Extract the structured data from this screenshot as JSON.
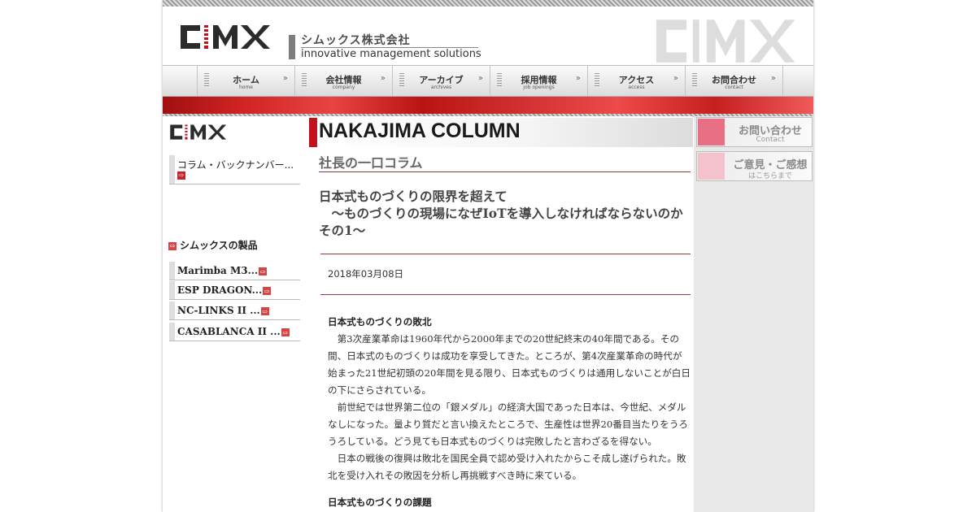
{
  "header": {
    "logo_text": "CIMX",
    "company_name": "シムックス株式会社",
    "tagline": "innovative management solutions"
  },
  "nav": {
    "items": [
      {
        "jp": "ホーム",
        "en": "home"
      },
      {
        "jp": "会社情報",
        "en": "company"
      },
      {
        "jp": "アーカイブ",
        "en": "archives"
      },
      {
        "jp": "採用情報",
        "en": "job openings"
      },
      {
        "jp": "アクセス",
        "en": "access"
      },
      {
        "jp": "お問合わせ",
        "en": "contact"
      }
    ]
  },
  "sidebar": {
    "logo_text": "CIMX",
    "backnumber": "コラム・バックナンバー...",
    "products_heading": "シムックスの製品",
    "products": [
      {
        "label": "Marimba M3..."
      },
      {
        "label": "ESP DRAGON..."
      },
      {
        "label": "NC-LINKS II ..."
      },
      {
        "label": "CASABLANCA II ..."
      }
    ]
  },
  "column": {
    "title": "NAKAJIMA COLUMN",
    "subtitle": "社長の一口コラム",
    "article_title_line1": "日本式ものづくりの限界を超えて",
    "article_title_line2": "　～ものづくりの現場になぜIoTを導入しなければならないのか　その1～",
    "date": "2018年03月08日",
    "heading1": "日本式ものづくりの敗北",
    "para1": "　第3次産業革命は1960年代から2000年までの20世紀終末の40年間である。その間、日本式のものづくりは成功を享受してきた。ところが、第4次産業革命の時代が始まった21世紀初頭の20年間を見る限り、日本式ものづくりは通用しないことが白日の下にさらされている。",
    "para2": "　前世紀では世界第二位の「銀メダル」の経済大国であった日本は、今世紀、メダルなしになった。量より質だと言い換えたところで、生産性は世界20番目当たりをうろうろしている。どう見ても日本式ものづくりは完敗したと言わざるを得ない。",
    "para3": "　日本の戦後の復興は敗北を国民全員で認め受け入れたからこそ成し遂げられた。敗北を受け入れその敗因を分析し再挑戦すべき時に来ている。",
    "heading2": "日本式ものづくりの課題"
  },
  "right_buttons": [
    {
      "label": "お問い合わせ",
      "sub": "Contact"
    },
    {
      "label": "ご意見・ご感想",
      "sub": "はこちらまで"
    }
  ],
  "colors": {
    "accent_red": "#c4101c",
    "link_arrow_red": "#d64545",
    "contact_pink": "#e86f84",
    "opinion_pink": "#f4c2cd"
  }
}
